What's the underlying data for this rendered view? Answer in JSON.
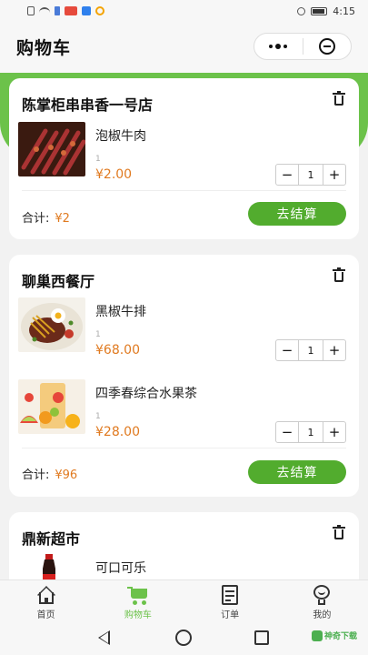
{
  "status_bar": {
    "time": "4:15"
  },
  "header": {
    "title": "购物车"
  },
  "shops": [
    {
      "name": "陈掌柜串串香一号店",
      "items": [
        {
          "name": "泡椒牛肉",
          "small_qty": "1",
          "price": "¥2.00",
          "qty": "1",
          "image_desc": "skewers"
        }
      ],
      "total_label": "合计:",
      "total_amount": "¥2",
      "checkout_label": "去结算"
    },
    {
      "name": "聊巢西餐厅",
      "items": [
        {
          "name": "黑椒牛排",
          "small_qty": "1",
          "price": "¥68.00",
          "qty": "1",
          "image_desc": "steak"
        },
        {
          "name": "四季春综合水果茶",
          "small_qty": "1",
          "price": "¥28.00",
          "qty": "1",
          "image_desc": "fruit-tea"
        }
      ],
      "total_label": "合计:",
      "total_amount": "¥96",
      "checkout_label": "去结算"
    },
    {
      "name": "鼎新超市",
      "items": [
        {
          "name": "可口可乐",
          "image_desc": "cola"
        }
      ]
    }
  ],
  "stepper": {
    "minus": "−",
    "plus": "+"
  },
  "tabbar": [
    {
      "label": "首页",
      "icon": "home-icon",
      "active": false
    },
    {
      "label": "购物车",
      "icon": "cart-icon",
      "active": true
    },
    {
      "label": "订单",
      "icon": "order-icon",
      "active": false
    },
    {
      "label": "我的",
      "icon": "profile-icon",
      "active": false
    }
  ],
  "watermark": {
    "text": "神奇下载"
  },
  "colors": {
    "accent": "#6cc24a",
    "button": "#52ac2e",
    "price": "#e07a20"
  }
}
